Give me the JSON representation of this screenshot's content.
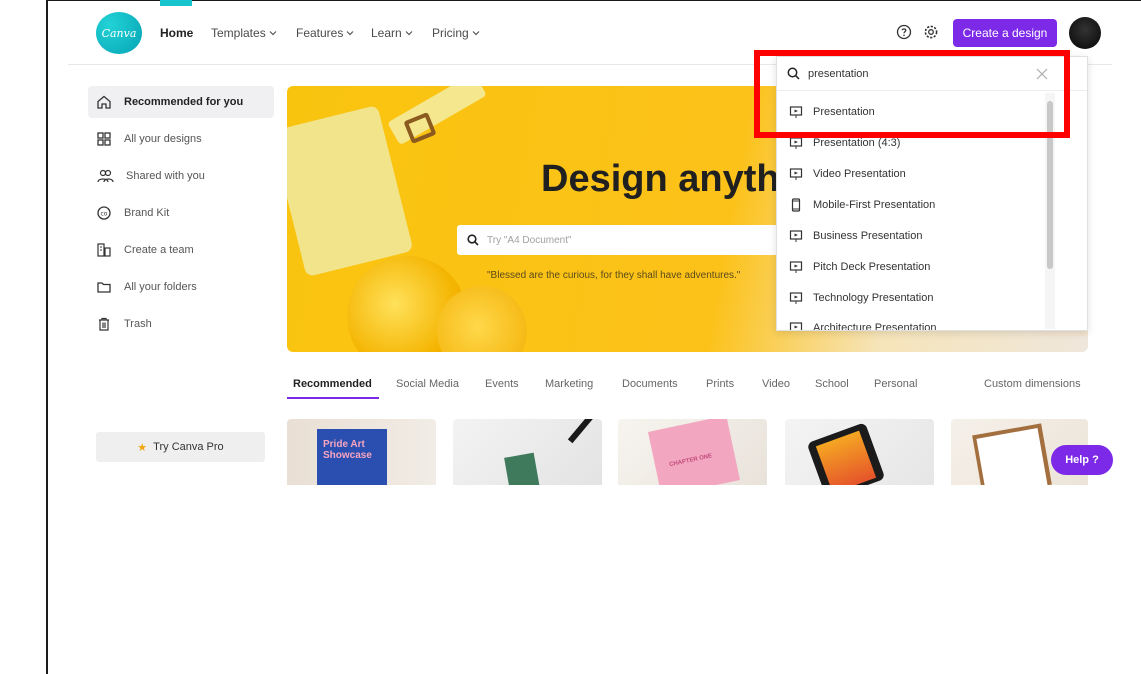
{
  "nav": {
    "logo": "Canva",
    "items": [
      {
        "label": "Home"
      },
      {
        "label": "Templates"
      },
      {
        "label": "Features"
      },
      {
        "label": "Learn"
      },
      {
        "label": "Pricing"
      }
    ],
    "help_icon": "question-circle-icon",
    "settings_icon": "gear-icon",
    "create_label": "Create a design"
  },
  "sidebar": {
    "items": [
      {
        "label": "Recommended for you",
        "icon": "home-icon"
      },
      {
        "label": "All your designs",
        "icon": "grid-icon"
      },
      {
        "label": "Shared with you",
        "icon": "users-icon"
      },
      {
        "label": "Brand Kit",
        "icon": "brand-icon"
      },
      {
        "label": "Create a team",
        "icon": "team-icon"
      },
      {
        "label": "All your folders",
        "icon": "folder-icon"
      },
      {
        "label": "Trash",
        "icon": "trash-icon"
      }
    ],
    "pro_label": "Try Canva Pro"
  },
  "hero": {
    "title": "Design anythi",
    "search_placeholder": "Try \"A4 Document\"",
    "quote": "\"Blessed are the curious, for they shall have adventures.\""
  },
  "tabs": [
    {
      "label": "Recommended"
    },
    {
      "label": "Social Media"
    },
    {
      "label": "Events"
    },
    {
      "label": "Marketing"
    },
    {
      "label": "Documents"
    },
    {
      "label": "Prints"
    },
    {
      "label": "Video"
    },
    {
      "label": "School"
    },
    {
      "label": "Personal"
    },
    {
      "label": "Custom dimensions"
    }
  ],
  "cards": {
    "card1_text": "Pride Art Showcase",
    "card3_text": "CHAPTER ONE"
  },
  "dropdown": {
    "query": "presentation",
    "items": [
      {
        "label": "Presentation",
        "icon": "presentation-icon"
      },
      {
        "label": "Presentation (4:3)",
        "icon": "presentation-icon"
      },
      {
        "label": "Video Presentation",
        "icon": "presentation-icon"
      },
      {
        "label": "Mobile-First Presentation",
        "icon": "mobile-icon"
      },
      {
        "label": "Business Presentation",
        "icon": "presentation-icon"
      },
      {
        "label": "Pitch Deck Presentation",
        "icon": "presentation-icon"
      },
      {
        "label": "Technology Presentation",
        "icon": "presentation-icon"
      },
      {
        "label": "Architecture Presentation",
        "icon": "presentation-icon"
      }
    ]
  },
  "help_label": "Help ?",
  "colors": {
    "accent": "#7d2ae8",
    "highlight": "#ff0000",
    "hero": "#f9c40e"
  }
}
